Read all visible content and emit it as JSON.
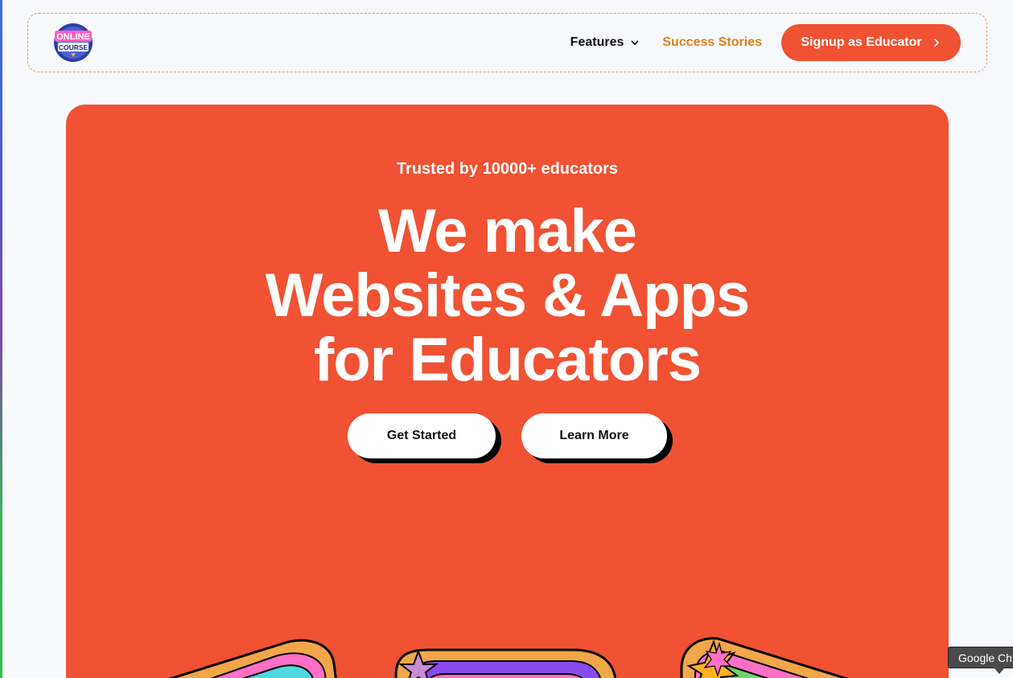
{
  "header": {
    "logo": {
      "line1": "ONLINE",
      "line2": "COURSE"
    },
    "nav": {
      "features_label": "Features",
      "success_label": "Success Stories",
      "signup_label": "Signup as Educator"
    }
  },
  "hero": {
    "trusted": "Trusted by 10000+ educators",
    "headline": [
      "We make",
      "Websites & Apps",
      "for Educators"
    ],
    "cta_primary": "Get Started",
    "cta_secondary": "Learn More"
  },
  "tooltip": {
    "text": "Google Ch"
  },
  "colors": {
    "accent": "#f05233",
    "success_link": "#e07f1b",
    "background": "#f7f9fc"
  },
  "icons": {
    "features_caret": "chevron-down-icon",
    "signup_arrow": "chevron-right-icon"
  }
}
